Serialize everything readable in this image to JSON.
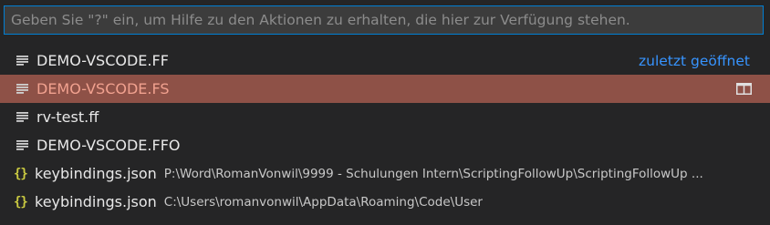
{
  "search": {
    "placeholder": "Geben Sie \"?\" ein, um Hilfe zu den Aktionen zu erhalten, die hier zur Verfügung stehen.",
    "value": ""
  },
  "items": [
    {
      "label": "DEMO-VSCODE.FF",
      "icon": "file-lines-icon",
      "hint": "zuletzt geöffnet"
    },
    {
      "label": "DEMO-VSCODE.FS",
      "icon": "file-lines-icon",
      "selected": true,
      "action_icon": "split-editor-icon"
    },
    {
      "label": "rv-test.ff",
      "icon": "file-lines-icon"
    },
    {
      "label": "DEMO-VSCODE.FFO",
      "icon": "file-lines-icon"
    },
    {
      "label": "keybindings.json",
      "icon": "json-braces-icon",
      "description": "P:\\Word\\RomanVonwil\\9999 - Schulungen Intern\\ScriptingFollowUp\\ScriptingFollowUp ..."
    },
    {
      "label": "keybindings.json",
      "icon": "json-braces-icon",
      "description": "C:\\Users\\romanvonwil\\AppData\\Roaming\\Code\\User"
    }
  ],
  "colors": {
    "background": "#252526",
    "input_border": "#007fd4",
    "selection": "#8e5147",
    "selected_text": "#f1a18f",
    "hint": "#3794ff",
    "json_icon": "#cbcb41"
  }
}
